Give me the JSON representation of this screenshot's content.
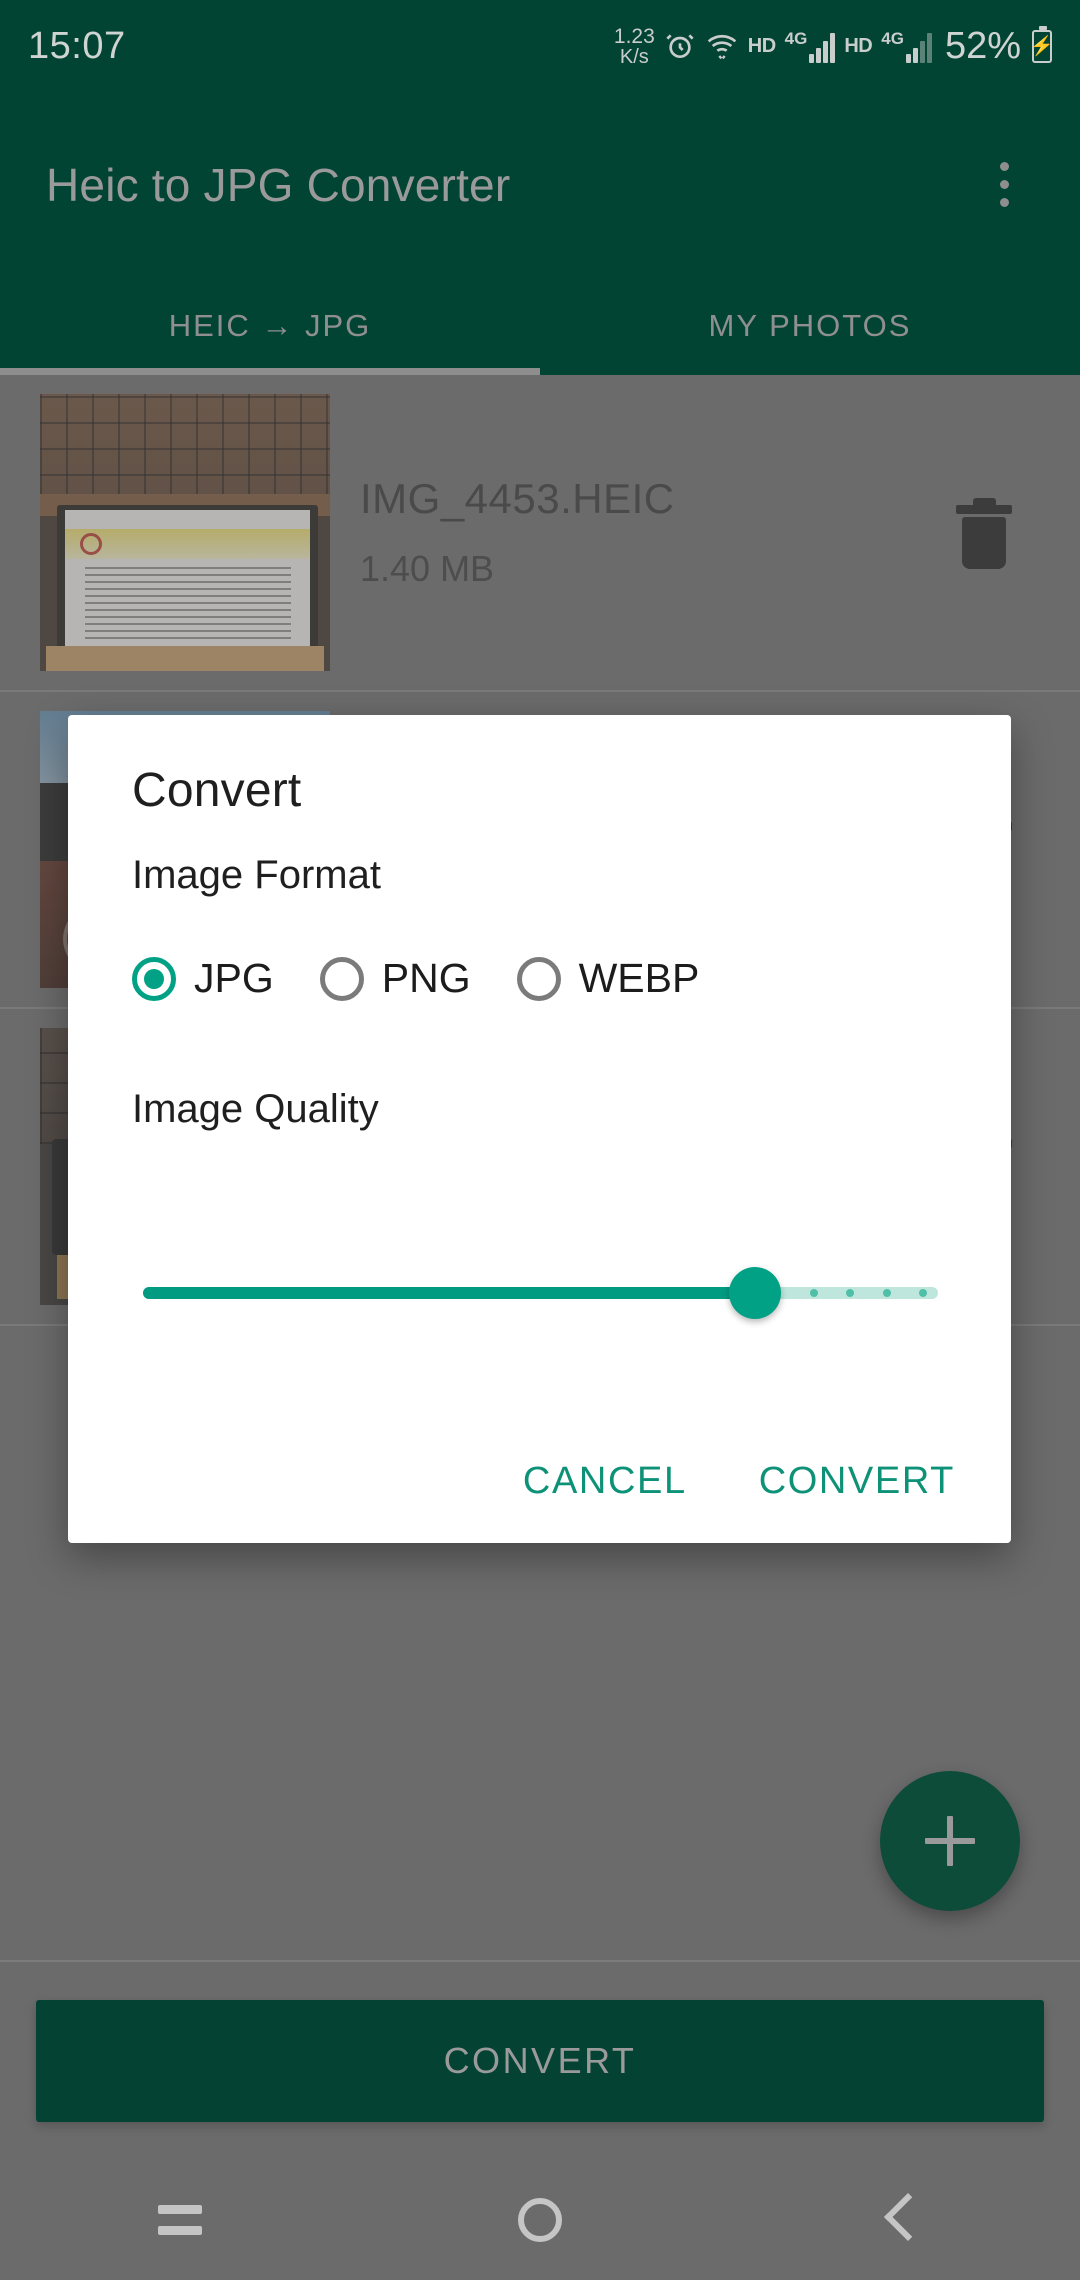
{
  "status_bar": {
    "clock": "15:07",
    "net_speed_value": "1.23",
    "net_speed_unit": "K/s",
    "hd_label_1": "HD",
    "network_1": "4G",
    "hd_label_2": "HD",
    "network_2": "4G",
    "battery_percent": "52%",
    "icons": [
      "alarm-icon",
      "wifi-icon",
      "signal-icon",
      "battery-charging-icon"
    ]
  },
  "app_bar": {
    "title": "Heic to JPG Converter",
    "overflow_label": "More options"
  },
  "tabs": [
    {
      "label": "HEIC → JPG",
      "active": true
    },
    {
      "label": "MY PHOTOS",
      "active": false
    }
  ],
  "file_list": [
    {
      "name": "IMG_4453.HEIC",
      "size": "1.40 MB",
      "thumb": "laptop-gpac-heif",
      "delete_label": "Delete"
    },
    {
      "name": "",
      "size": "",
      "thumb": "sea-desk",
      "delete_label": "Delete"
    },
    {
      "name": "",
      "size": "",
      "thumb": "desk-laptop",
      "delete_label": "Delete"
    }
  ],
  "dialog": {
    "title": "Convert",
    "format_section_label": "Image Format",
    "format_options": [
      {
        "label": "JPG",
        "selected": true
      },
      {
        "label": "PNG",
        "selected": false
      },
      {
        "label": "WEBP",
        "selected": false
      }
    ],
    "quality_section_label": "Image Quality",
    "quality_slider": {
      "value_percent": 77,
      "min": 0,
      "max": 100,
      "tick_count": 4
    },
    "cancel_label": "CANCEL",
    "confirm_label": "CONVERT"
  },
  "fab": {
    "label": "+",
    "name": "add-photos-fab"
  },
  "bottom_bar": {
    "convert_label": "CONVERT"
  },
  "nav_bar": {
    "recents_label": "Recents",
    "home_label": "Home",
    "back_label": "Back"
  },
  "colors": {
    "app_bar_green": "#024434",
    "accent_teal": "#00a184",
    "dialog_action_teal": "#0e9277",
    "fab_green": "#0d4c39",
    "scrim_gray": "#6b6b6b"
  }
}
